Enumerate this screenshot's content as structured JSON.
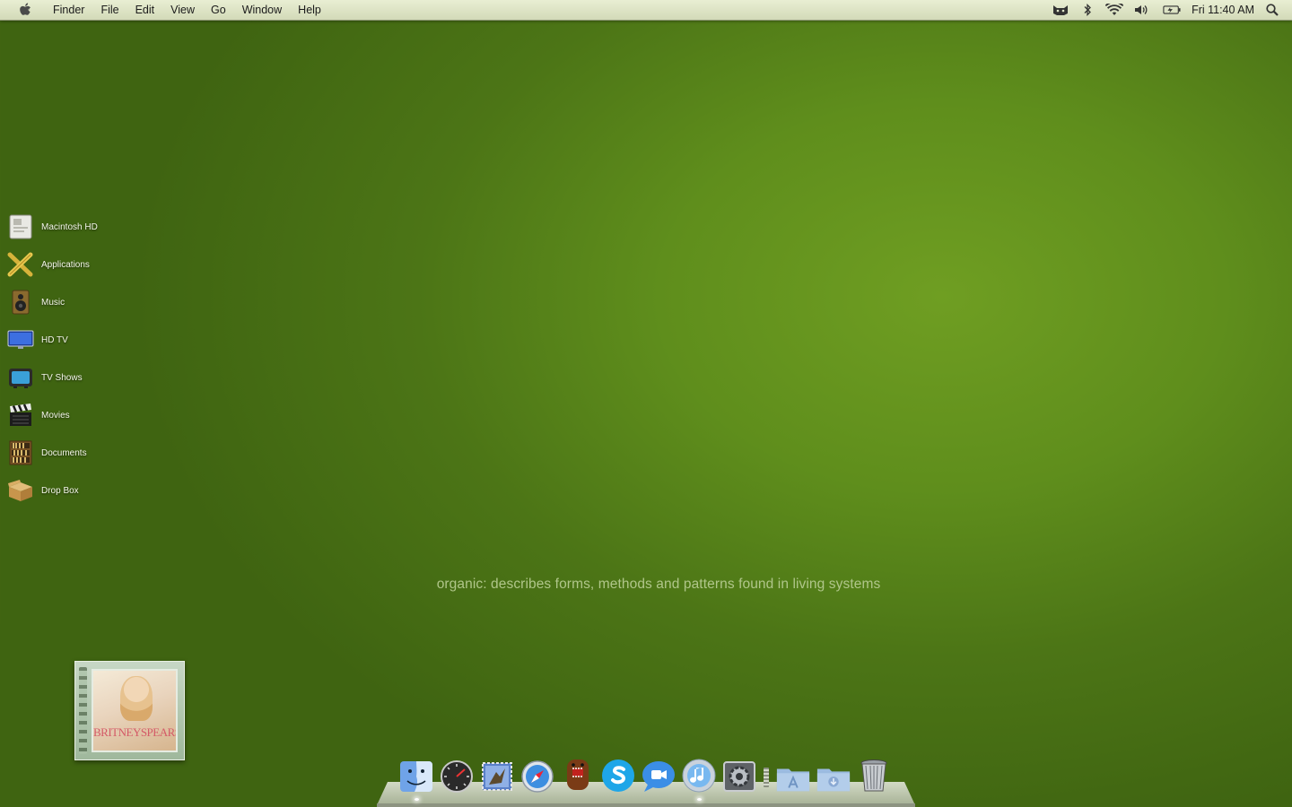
{
  "menubar": {
    "apple_icon": "apple-icon",
    "app_name": "Finder",
    "menus": [
      "File",
      "Edit",
      "View",
      "Go",
      "Window",
      "Help"
    ],
    "status_icons": [
      "cat-icon",
      "bluetooth-icon",
      "wifi-icon",
      "volume-icon",
      "battery-icon"
    ],
    "clock": "Fri 11:40 AM",
    "spotlight_icon": "search-icon"
  },
  "desktop": {
    "items": [
      {
        "label": "Macintosh HD",
        "icon": "hard-drive-icon"
      },
      {
        "label": "Applications",
        "icon": "applications-icon"
      },
      {
        "label": "Music",
        "icon": "speaker-icon"
      },
      {
        "label": "HD TV",
        "icon": "monitor-icon"
      },
      {
        "label": "TV Shows",
        "icon": "tv-icon"
      },
      {
        "label": "Movies",
        "icon": "clapperboard-icon"
      },
      {
        "label": "Documents",
        "icon": "bookshelf-icon"
      },
      {
        "label": "Drop Box",
        "icon": "box-icon"
      }
    ],
    "tagline": "organic: describes forms, methods and patterns found in living systems"
  },
  "album_widget": {
    "cover_text": "BRITNEYSPEARS"
  },
  "dock": {
    "apps": [
      "finder-icon",
      "dashboard-icon",
      "mail-icon",
      "safari-icon",
      "domo-icon",
      "skype-icon",
      "ichat-icon",
      "itunes-icon",
      "system-preferences-icon"
    ],
    "stacks": [
      "applications-folder-icon",
      "downloads-folder-icon",
      "trash-icon"
    ]
  },
  "colors": {
    "desktop_green": "#5f8e1c",
    "menubar": "#dfe4c6",
    "tagline": "#b0c68a"
  }
}
